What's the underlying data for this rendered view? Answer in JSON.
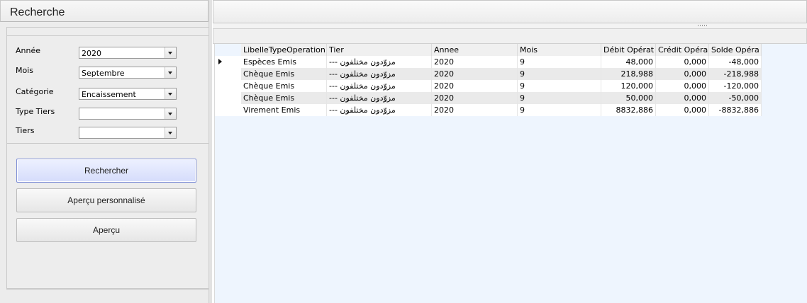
{
  "search_panel": {
    "title": "Recherche",
    "fields": [
      {
        "label": "Année",
        "value": "2020"
      },
      {
        "label": "Mois",
        "value": "Septembre"
      },
      {
        "label": "Catégorie",
        "value": "Encaissement"
      },
      {
        "label": "Type Tiers",
        "value": ""
      },
      {
        "label": "Tiers",
        "value": ""
      }
    ],
    "buttons": {
      "search": "Rechercher",
      "custom_preview": "Aperçu personnalisé",
      "preview": "Aperçu"
    }
  },
  "grid": {
    "columns": [
      "LibelleTypeOperation",
      "Tier",
      "Annee",
      "Mois",
      "Débit Opérat",
      "Crédit Opéra",
      "Solde Opéra"
    ],
    "rows": [
      [
        "Espèces Emis",
        "--- مزوّدون مختلفون",
        "2020",
        "9",
        "48,000",
        "0,000",
        "-48,000"
      ],
      [
        "Chèque Emis",
        "--- مزوّدون مختلفون",
        "2020",
        "9",
        "218,988",
        "0,000",
        "-218,988"
      ],
      [
        "Chèque Emis",
        "--- مزوّدون مختلفون",
        "2020",
        "9",
        "120,000",
        "0,000",
        "-120,000"
      ],
      [
        "Chèque Emis",
        "--- مزوّدون مختلفون",
        "2020",
        "9",
        "50,000",
        "0,000",
        "-50,000"
      ],
      [
        "Virement Emis",
        "--- مزوّدون مختلفون",
        "2020",
        "9",
        "8832,886",
        "0,000",
        "-8832,886"
      ]
    ]
  },
  "colors": {
    "panel_background": "#ececec",
    "grid_background": "#eef5fe",
    "primary_button": "#d5dcfb",
    "alt_row": "#eaeaea"
  }
}
